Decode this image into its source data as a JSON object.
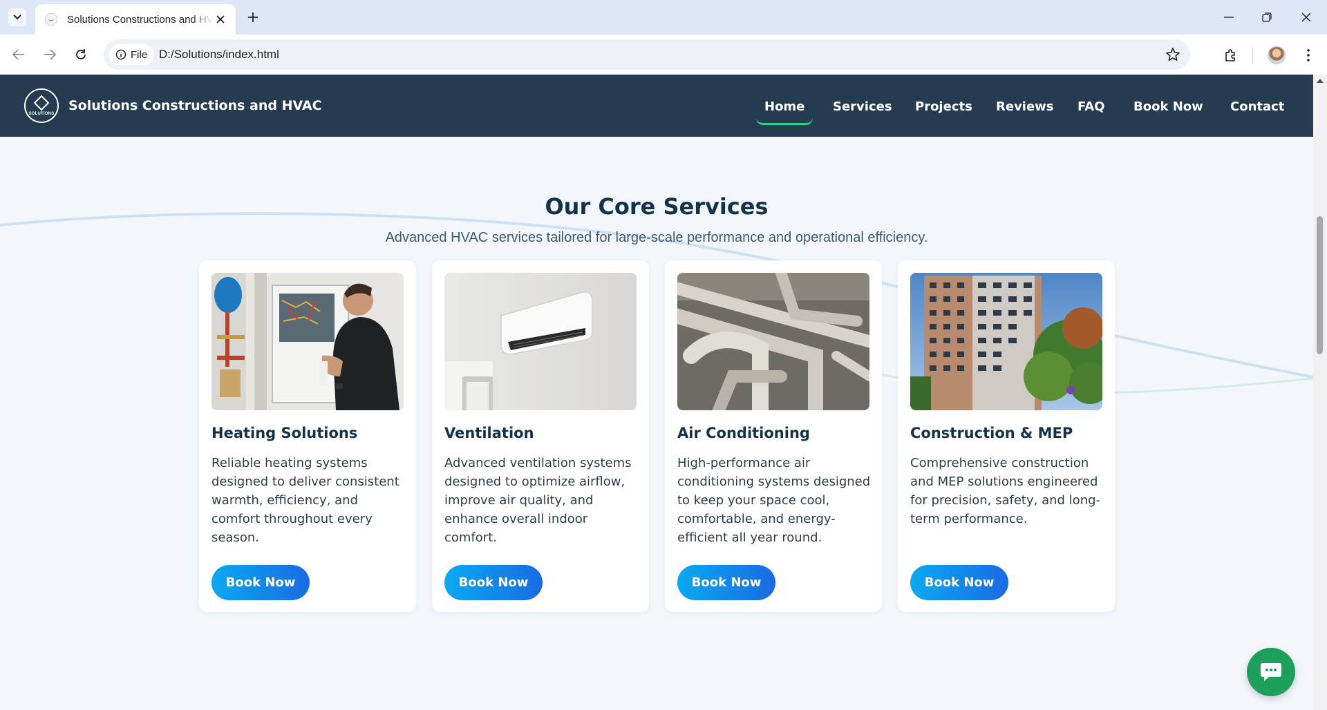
{
  "browser": {
    "tab_title": "Solutions Constructions and HVAC",
    "url_chip": "File",
    "url": "D:/Solutions/index.html"
  },
  "site": {
    "name": "Solutions Constructions and HVAC",
    "logo_text": "SOLUTIONS",
    "nav": [
      {
        "label": "Home",
        "active": true
      },
      {
        "label": "Services",
        "active": false
      },
      {
        "label": "Projects",
        "active": false
      },
      {
        "label": "Reviews",
        "active": false
      },
      {
        "label": "FAQ",
        "active": false
      },
      {
        "label": "Book Now",
        "active": false
      },
      {
        "label": "Contact",
        "active": false
      }
    ],
    "colors": {
      "header": "#253c50",
      "nav_active_underline": "#2fd08c",
      "button_gradient_start": "#0aa9f2",
      "button_gradient_end": "#1a6ae2",
      "chat": "#1ea05c"
    }
  },
  "services": {
    "title": "Our Core Services",
    "subtitle": "Advanced HVAC services tailored for large-scale performance and operational efficiency.",
    "cards": [
      {
        "title": "Heating Solutions",
        "description": "Reliable heating systems designed to deliver consistent warmth, efficiency, and comfort throughout every season.",
        "button": "Book Now",
        "image": "technician-boiler-photo"
      },
      {
        "title": "Ventilation",
        "description": "Advanced ventilation systems designed to optimize airflow, improve air quality, and enhance overall indoor comfort.",
        "button": "Book Now",
        "image": "wall-air-conditioner-photo"
      },
      {
        "title": "Air Conditioning",
        "description": "High-performance air conditioning systems designed to keep your space cool, comfortable, and energy-efficient all year round.",
        "button": "Book Now",
        "image": "industrial-pipes-photo"
      },
      {
        "title": "Construction & MEP",
        "description": "Comprehensive construction and MEP solutions engineered for precision, safety, and long-term performance.",
        "button": "Book Now",
        "image": "apartment-building-photo"
      }
    ]
  },
  "chat_widget": {
    "icon": "chat-bubble-icon"
  }
}
